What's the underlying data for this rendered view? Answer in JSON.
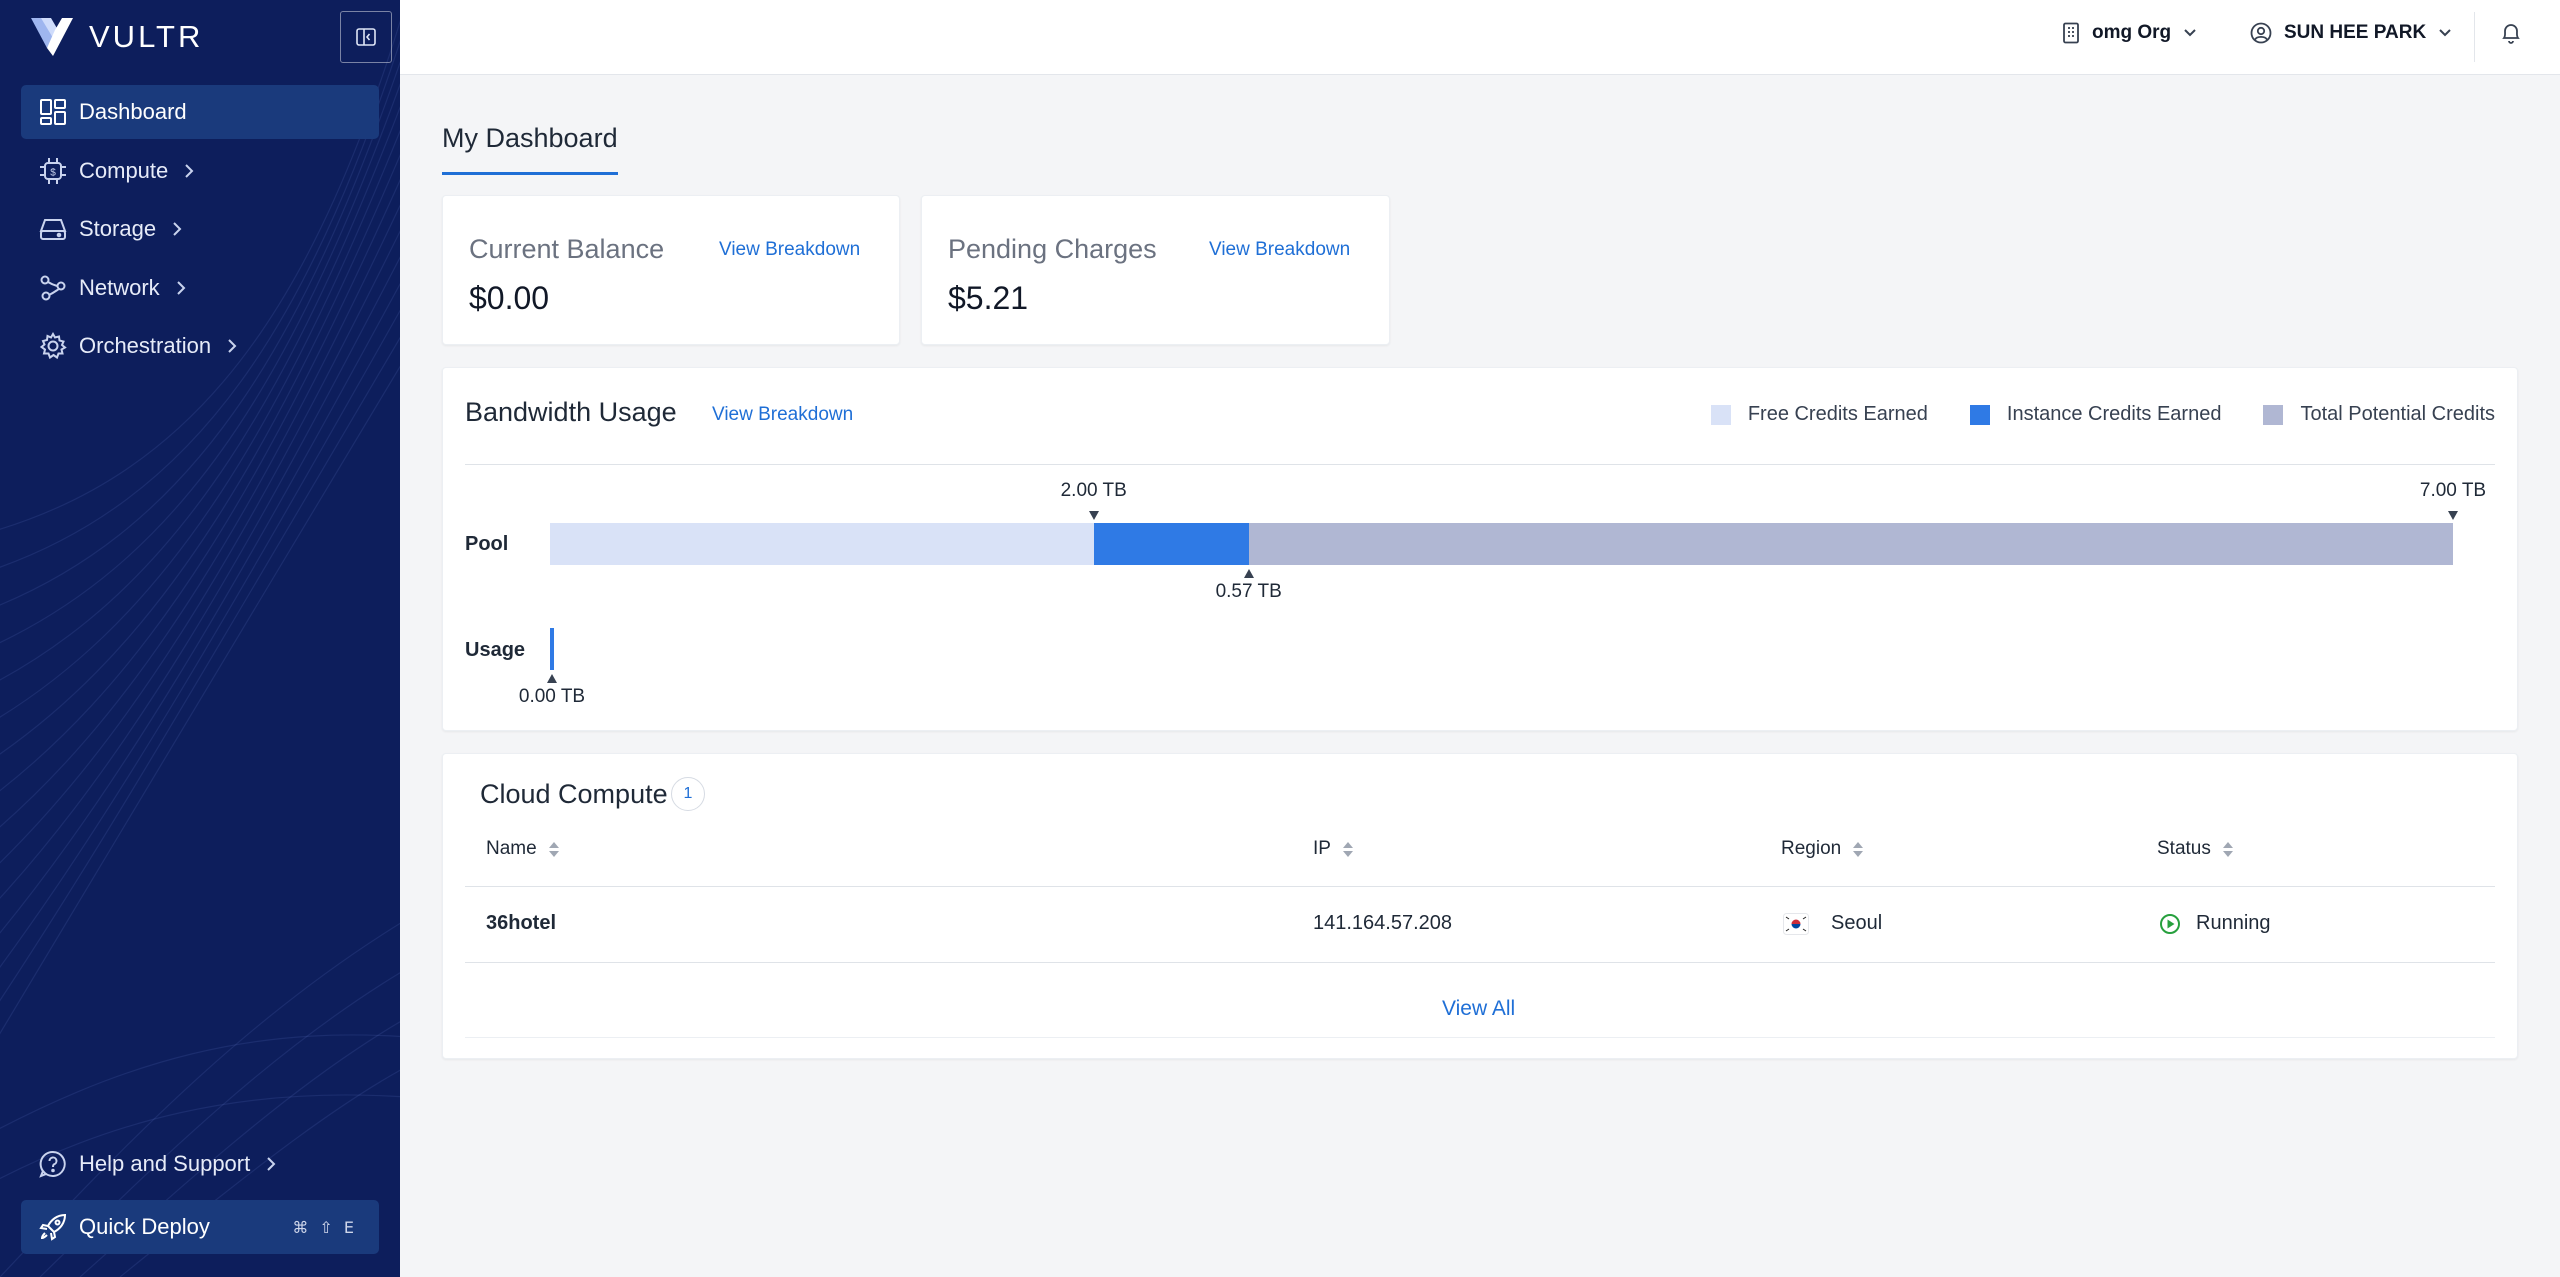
{
  "brand": {
    "logo_text": "VULTR"
  },
  "sidebar": {
    "items": [
      {
        "label": "Dashboard",
        "icon": "dashboard-icon",
        "active": true
      },
      {
        "label": "Compute",
        "icon": "chip-icon"
      },
      {
        "label": "Storage",
        "icon": "storage-icon"
      },
      {
        "label": "Network",
        "icon": "network-icon"
      },
      {
        "label": "Orchestration",
        "icon": "gear-icon"
      }
    ],
    "help_label": "Help and Support",
    "quick_deploy_label": "Quick Deploy",
    "quick_deploy_shortcut": "⌘ ⇧ E"
  },
  "topbar": {
    "org_label": "omg Org",
    "user_label": "SUN HEE PARK"
  },
  "page": {
    "title": "My Dashboard"
  },
  "balance": {
    "current_label": "Current Balance",
    "current_value": "$0.00",
    "pending_label": "Pending Charges",
    "pending_value": "$5.21",
    "link": "View Breakdown"
  },
  "bandwidth": {
    "title": "Bandwidth Usage",
    "link": "View Breakdown",
    "legend": [
      "Free Credits Earned",
      "Instance Credits Earned",
      "Total Potential Credits"
    ],
    "pool_label": "Pool",
    "usage_label": "Usage",
    "marker_free": "2.00 TB",
    "marker_total": "7.00 TB",
    "marker_instance": "0.57 TB",
    "marker_usage": "0.00 TB",
    "colors": {
      "free": "#d9e2f7",
      "instance": "#2f7ae5",
      "total": "#b0b7d3"
    }
  },
  "chart_data": {
    "type": "bar",
    "categories": [
      "Pool",
      "Usage"
    ],
    "series": [
      {
        "name": "Free Credits Earned",
        "values": [
          2.0,
          0
        ]
      },
      {
        "name": "Instance Credits Earned",
        "values": [
          0.57,
          0
        ]
      },
      {
        "name": "Total Potential Credits",
        "values": [
          4.43,
          0
        ]
      }
    ],
    "usage_tb": 0.0,
    "pool_total_tb": 7.0,
    "unit": "TB"
  },
  "cloud_compute": {
    "title": "Cloud Compute",
    "count": "1",
    "columns": [
      "Name",
      "IP",
      "Region",
      "Status"
    ],
    "rows": [
      {
        "name": "36hotel",
        "ip": "141.164.57.208",
        "region": "Seoul",
        "status": "Running"
      }
    ],
    "view_all": "View All"
  }
}
